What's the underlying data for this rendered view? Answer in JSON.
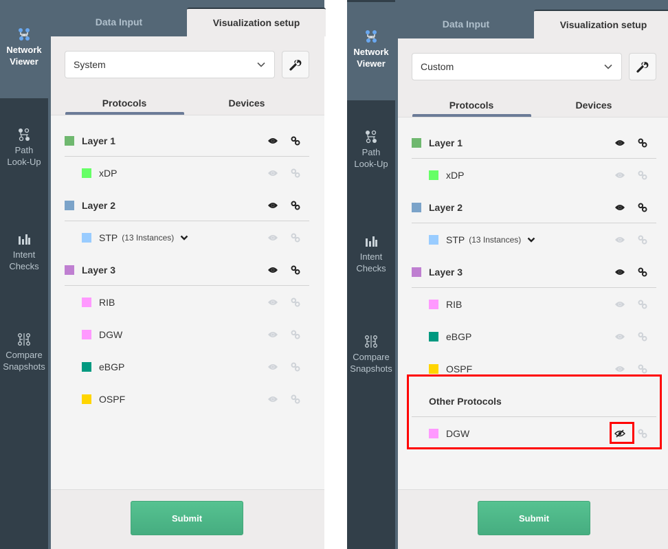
{
  "panels": [
    {
      "id": "left",
      "rail": [
        {
          "key": "network-viewer",
          "label_1": "Network",
          "label_2": "Viewer",
          "icon": "network-topology-icon",
          "active": true
        },
        {
          "key": "path-lookup",
          "label_1": "Path",
          "label_2": "Look-Up",
          "icon": "path-lookup-icon",
          "active": false
        },
        {
          "key": "intent-checks",
          "label_1": "Intent",
          "label_2": "Checks",
          "icon": "bar-chart-icon",
          "active": false
        },
        {
          "key": "compare-snapshots",
          "label_1": "Compare",
          "label_2": "Snapshots",
          "icon": "compare-icon",
          "active": false
        }
      ],
      "tabs": {
        "data_input": "Data Input",
        "visualization_setup": "Visualization setup",
        "active": "visualization_setup"
      },
      "preset_select": {
        "value": "System"
      },
      "subtabs": {
        "protocols": "Protocols",
        "devices": "Devices",
        "active": "protocols"
      },
      "groups": [
        {
          "name": "Layer 1",
          "color": "#6fb86f",
          "visible": true,
          "linked": true,
          "items": [
            {
              "name": "xDP",
              "color": "#66ff66",
              "visible": false,
              "linked": false
            }
          ]
        },
        {
          "name": "Layer 2",
          "color": "#7ba3c9",
          "visible": true,
          "linked": true,
          "items": [
            {
              "name": "STP",
              "instances": "(13 Instances)",
              "color": "#99ccff",
              "visible": false,
              "linked": false,
              "expandable": true
            }
          ]
        },
        {
          "name": "Layer 3",
          "color": "#bf7fd1",
          "visible": true,
          "linked": true,
          "items": [
            {
              "name": "RIB",
              "color": "#ff99ff",
              "visible": false,
              "linked": false
            },
            {
              "name": "DGW",
              "color": "#ff99ff",
              "visible": false,
              "linked": false
            },
            {
              "name": "eBGP",
              "color": "#009980",
              "visible": false,
              "linked": false
            },
            {
              "name": "OSPF",
              "color": "#ffd500",
              "visible": false,
              "linked": false
            }
          ]
        }
      ],
      "submit_label": "Submit"
    },
    {
      "id": "right",
      "rail": [
        {
          "key": "network-viewer",
          "label_1": "Network",
          "label_2": "Viewer",
          "icon": "network-topology-icon",
          "active": true
        },
        {
          "key": "path-lookup",
          "label_1": "Path",
          "label_2": "Look-Up",
          "icon": "path-lookup-icon",
          "active": false
        },
        {
          "key": "intent-checks",
          "label_1": "Intent",
          "label_2": "Checks",
          "icon": "bar-chart-icon",
          "active": false
        },
        {
          "key": "compare-snapshots",
          "label_1": "Compare",
          "label_2": "Snapshots",
          "icon": "compare-icon",
          "active": false
        }
      ],
      "tabs": {
        "data_input": "Data Input",
        "visualization_setup": "Visualization setup",
        "active": "visualization_setup"
      },
      "preset_select": {
        "value": "Custom"
      },
      "subtabs": {
        "protocols": "Protocols",
        "devices": "Devices",
        "active": "protocols"
      },
      "groups": [
        {
          "name": "Layer 1",
          "color": "#6fb86f",
          "visible": true,
          "linked": true,
          "items": [
            {
              "name": "xDP",
              "color": "#66ff66",
              "visible": false,
              "linked": false
            }
          ]
        },
        {
          "name": "Layer 2",
          "color": "#7ba3c9",
          "visible": true,
          "linked": true,
          "items": [
            {
              "name": "STP",
              "instances": "(13 Instances)",
              "color": "#99ccff",
              "visible": false,
              "linked": false,
              "expandable": true
            }
          ]
        },
        {
          "name": "Layer 3",
          "color": "#bf7fd1",
          "visible": true,
          "linked": true,
          "items": [
            {
              "name": "RIB",
              "color": "#ff99ff",
              "visible": false,
              "linked": false
            },
            {
              "name": "eBGP",
              "color": "#009980",
              "visible": false,
              "linked": false
            },
            {
              "name": "OSPF",
              "color": "#ffd500",
              "visible": false,
              "linked": false
            }
          ]
        },
        {
          "name": "Other Protocols",
          "color": null,
          "visible": null,
          "linked": null,
          "highlighted": true,
          "items": [
            {
              "name": "DGW",
              "color": "#ff99ff",
              "visible": "hidden",
              "linked": false,
              "highlighted_icon": true
            }
          ]
        }
      ],
      "submit_label": "Submit"
    }
  ],
  "colors": {
    "rail_bg": "#323f49",
    "header_bg": "#546776",
    "accent_tab": "#6b7b97",
    "submit_green": "#4fb886",
    "highlight_red": "#ff0000",
    "icon_active": "#222222",
    "icon_inactive": "#cfd3d8"
  }
}
